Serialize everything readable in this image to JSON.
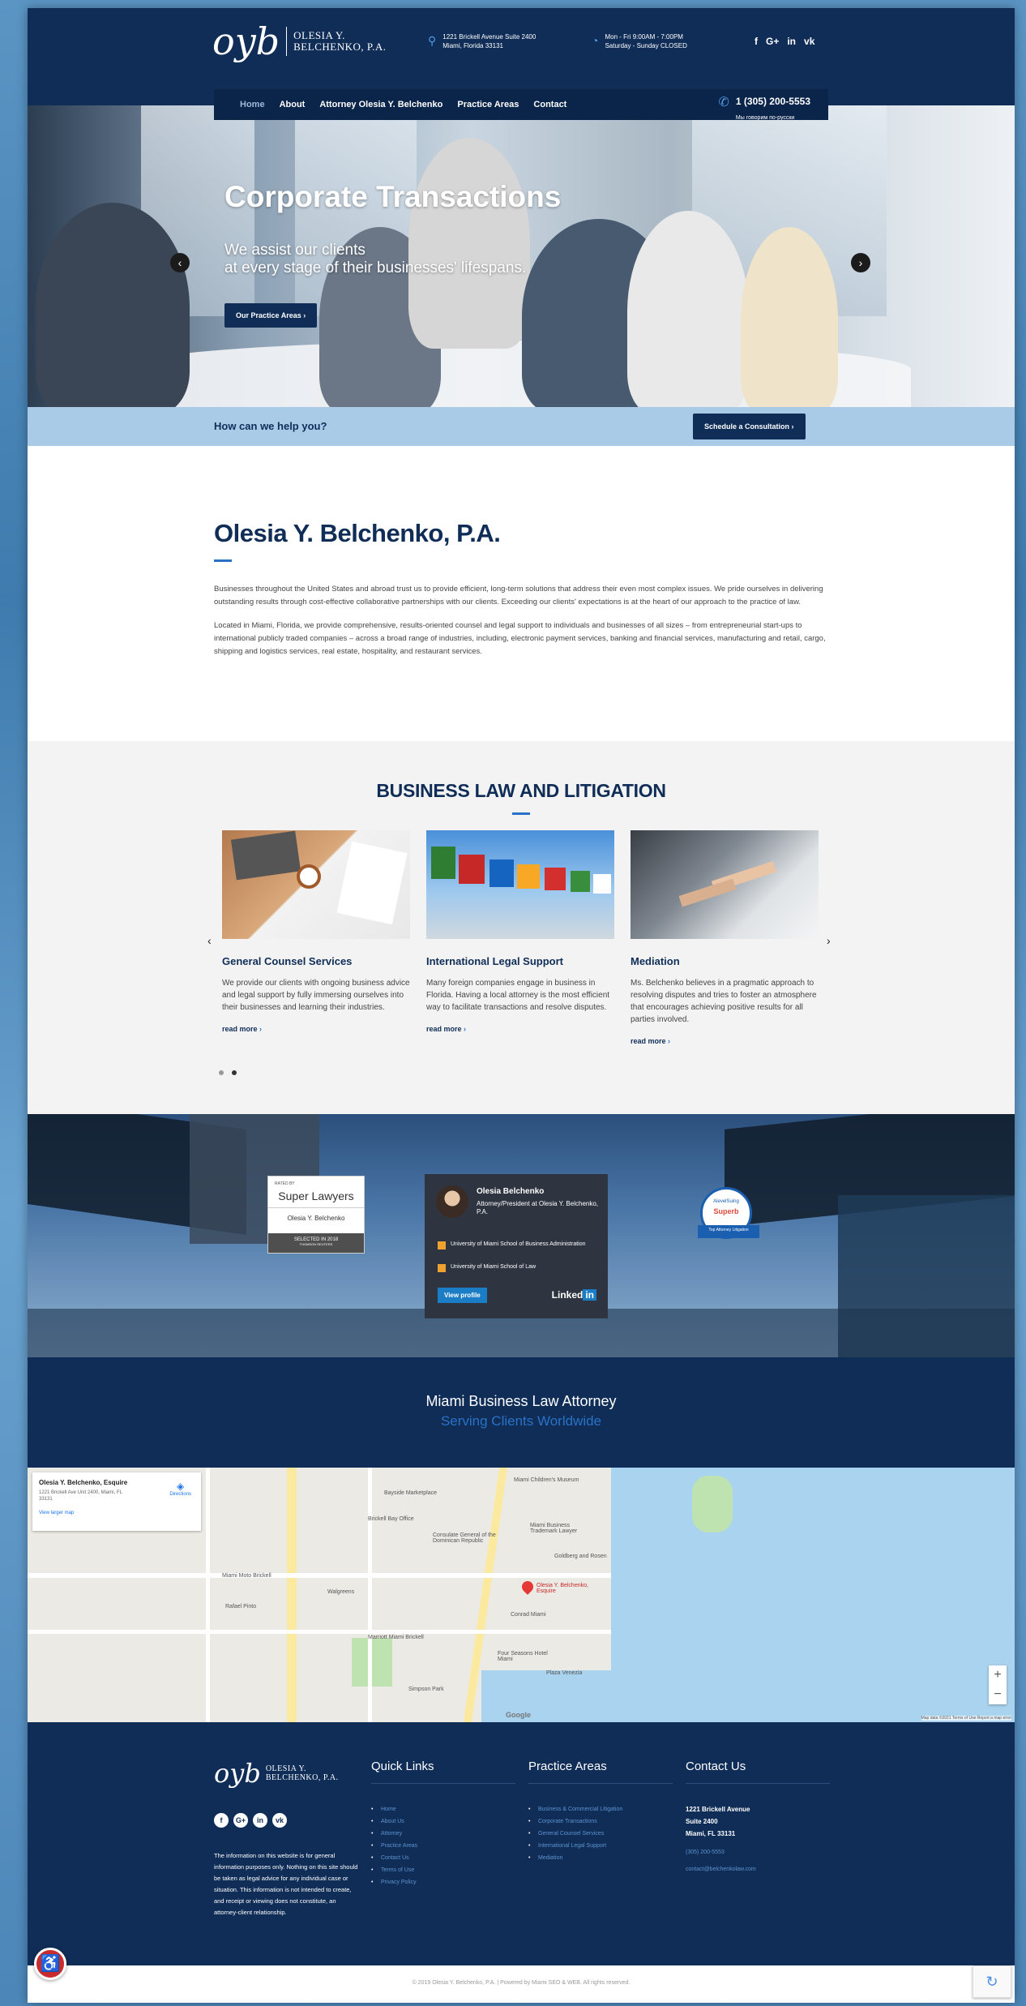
{
  "brand": {
    "mark": "oyb",
    "name_line1": "OLESIA Y.",
    "name_line2": "BELCHENKO, P.A."
  },
  "header": {
    "address_line1": "1221 Brickell Avenue Suite 2400",
    "address_line2": "Miami, Florida 33131",
    "hours_line1": "Mon - Fri 9:00AM - 7:00PM",
    "hours_line2": "Saturday - Sunday CLOSED",
    "social": [
      "f",
      "G+",
      "in",
      "vk"
    ]
  },
  "nav": {
    "items": [
      "Home",
      "About",
      "Attorney Olesia Y. Belchenko",
      "Practice Areas",
      "Contact"
    ],
    "phone": "1 (305) 200-5553",
    "phone_sub": "Мы говорим по-русски"
  },
  "hero": {
    "title": "Corporate Transactions",
    "subtitle_line1": "We assist our clients",
    "subtitle_line2": "at every stage of their businesses' lifespans.",
    "button": "Our Practice Areas ›"
  },
  "help": {
    "question": "How can we help you?",
    "button": "Schedule a Consultation ›"
  },
  "intro": {
    "title": "Olesia Y. Belchenko, P.A.",
    "p1": "Businesses throughout the United States and abroad trust us to provide efficient, long-term solutions that address their even most complex issues. We pride ourselves in delivering outstanding results through cost-effective collaborative partnerships with our clients. Exceeding our clients' expectations is at the heart of our approach to the practice of law.",
    "p2": "Located in Miami, Florida, we provide comprehensive, results-oriented counsel and legal support to individuals and businesses of all sizes – from entrepreneurial start-ups to international publicly traded companies – across a broad range of industries, including, electronic payment services, banking and financial services, manufacturing and retail, cargo, shipping and logistics services, real estate, hospitality, and restaurant services."
  },
  "practice": {
    "title": "BUSINESS LAW AND LITIGATION",
    "cards": [
      {
        "title": "General Counsel Services",
        "text": "We provide our clients with ongoing business advice and legal support by fully immersing ourselves into their businesses and learning their industries.",
        "more": "read more"
      },
      {
        "title": "International Legal Support",
        "text": "Many foreign companies engage in business in Florida. Having a local attorney is the most efficient way to facilitate transactions and resolve disputes.",
        "more": "read more"
      },
      {
        "title": "Mediation",
        "text": "Ms. Belchenko believes in a pragmatic approach to resolving disputes and tries to foster an atmosphere that encourages achieving positive results for all parties involved.",
        "more": "read more"
      }
    ]
  },
  "creds": {
    "sl_small": "RATED BY",
    "sl_brand": "Super Lawyers",
    "sl_name": "Olesia Y. Belchenko",
    "sl_selected": "SELECTED IN 2018",
    "sl_selected_sub": "THOMSON REUTERS",
    "li_name": "Olesia Belchenko",
    "li_title": "Attorney/President at Olesia Y. Belchenko, P.A.",
    "li_edu1": "University of Miami School of Business Administration",
    "li_edu2": "University of Miami School of Law",
    "li_view": "View profile",
    "li_brand": "Linked",
    "li_brand_in": "in",
    "sp_top": "AlevelSuing",
    "sp_brand": "Superb",
    "sp_rib": "Top Attorney Litigation"
  },
  "tagline": {
    "line1": "Miami Business Law Attorney",
    "line2": "Serving Clients Worldwide"
  },
  "map": {
    "card_name": "Olesia Y. Belchenko, Esquire",
    "card_addr": "1221 Brickell Ave Unit 2400, Miami, FL 33131",
    "card_link": "View larger map",
    "card_dir": "Directions",
    "pin_label": "Olesia Y. Belchenko, Esquire",
    "labels": [
      "Miami Children's Museum",
      "Bayside Marketplace",
      "Consulate General of the Dominican Republic",
      "Miami Business Trademark Lawyer",
      "Goldberg and Rosen",
      "Conrad Miami",
      "Four Seasons Hotel Miami",
      "Walgreens",
      "Marriott Miami Brickell",
      "Brickell Bay Office",
      "Miami Moto Brickell",
      "Rafael Pinto",
      "Simpson Park",
      "Plaza Venezia",
      "Google"
    ],
    "footer": "Map data ©2021   Terms of Use   Report a map error"
  },
  "footer": {
    "disclaimer": "The information on this website is for general information purposes only. Nothing on this site should be taken as legal advice for any individual case or situation. This information is not intended to create, and receipt or viewing does not constitute, an attorney-client relationship.",
    "quick_title": "Quick Links",
    "quick": [
      "Home",
      "About Us",
      "Attorney",
      "Practice Areas",
      "Contact Us",
      "Terms of Use",
      "Privacy Policy"
    ],
    "areas_title": "Practice Areas",
    "areas": [
      "Business & Commercial Litigation",
      "Corporate Transactions",
      "General Counsel Services",
      "International Legal Support",
      "Mediation"
    ],
    "contact_title": "Contact Us",
    "addr1": "1221 Brickell Avenue",
    "addr2": "Suite 2400",
    "addr3": "Miami, FL 33131",
    "phone": "(305) 200-5553",
    "email": "contact@belchenkolaw.com",
    "copyright": "© 2019 Olesia Y. Belchenko, P.A. | Powered by Miami SEO & WEB. All rights reserved."
  },
  "icons": [
    "location-icon",
    "clock-icon",
    "phone-icon",
    "arrow-left-icon",
    "arrow-right-icon",
    "accessibility-icon",
    "recaptcha-icon"
  ]
}
